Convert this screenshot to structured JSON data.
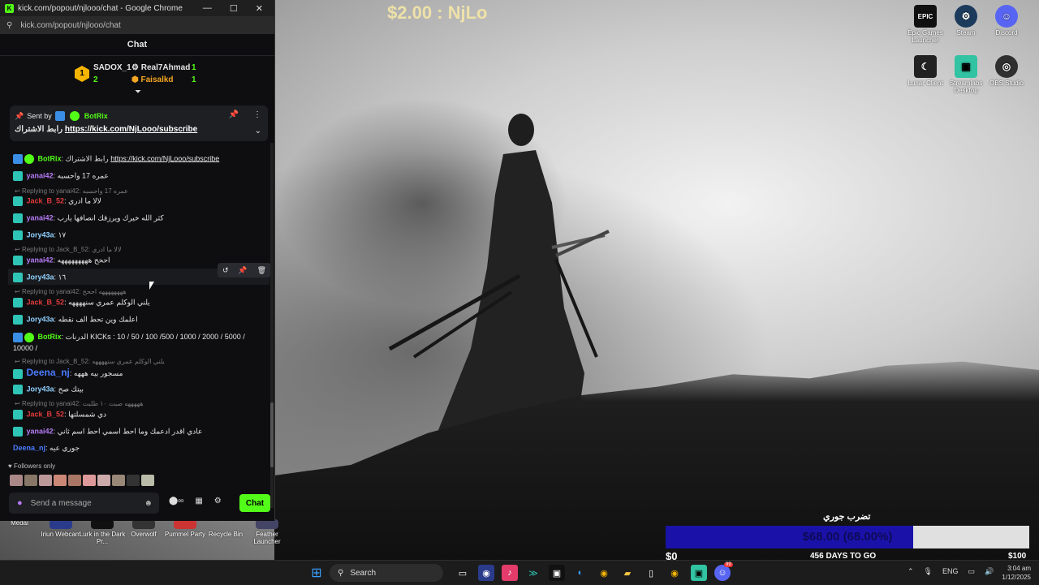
{
  "browser": {
    "window_title": "kick.com/popout/njlooo/chat - Google Chrome",
    "url": "kick.com/popout/njlooo/chat",
    "minimize": "—",
    "maximize": "☐",
    "close": "✕"
  },
  "chat": {
    "header": "Chat",
    "leaderboard": {
      "rank": "1",
      "top": {
        "name": "SADOX_1",
        "count": "2"
      },
      "second": {
        "name": "Real7Ahmad",
        "count": "1"
      },
      "third": {
        "name": "Faisalkd",
        "count": "1"
      }
    },
    "pinned": {
      "sent_by_label": "Sent by",
      "user": "BotRix",
      "text": "رابط الاشتراك",
      "link": "https://kick.com/NjLooo/subscribe"
    },
    "messages": [
      {
        "user": "BotRix",
        "text": "رابط الاشتراك",
        "link": "https://kick.com/NjLooo/subscribe"
      },
      {
        "user": "yanai42",
        "text": "عمره 17 واحسبه"
      },
      {
        "reply": "Replying to yanai42: عمره 17 واحسبه",
        "user": "Jack_B_52",
        "text": "لالا ما ادري"
      },
      {
        "user": "yanai42",
        "text": "كثر الله خيرك ويرزقك انصافها يارب"
      },
      {
        "user": "Jory43a",
        "text": "١٧"
      },
      {
        "reply": "Replying to Jack_B_52: لالا ما ادري",
        "user": "yanai42",
        "text": "اححح هههههههههه"
      },
      {
        "user": "Jory43a",
        "text": "١٦"
      },
      {
        "reply": "Replying to yanai42: ههههههههه اححح",
        "user": "Jack_B_52",
        "text": "يلني الوكلم عمري سنههههه"
      },
      {
        "user": "Jory43a",
        "text": "اعلمك وين تحط الف نقطه"
      },
      {
        "user": "BotRix",
        "text": "الدرنات KICKs : 10 / 50 / 100 /500 / 1000 / 2000 / 5000 / 10000 /"
      },
      {
        "reply": "Replying to Jack_B_52: يلني الوكلم عمري سنههههه",
        "user": "Deena_nj",
        "text": "مسجور بيه هههه"
      },
      {
        "user": "Jory43a",
        "text": "بيتك صح"
      },
      {
        "reply": "Replying to yanai42: هههههه صبت ١٠ طلبت",
        "user": "Jack_B_52",
        "text": "دي شمسلتها"
      },
      {
        "user": "yanai42",
        "text": "عادي اقدر ادعمك وما احط اسمي احط اسم ثاني"
      },
      {
        "user": "Deena_nj",
        "text": "جوري عيه"
      }
    ],
    "followers_only": "Followers only",
    "input_placeholder": "Send a message",
    "infinity": "∞",
    "send_button": "Chat"
  },
  "overlay": {
    "donation": "$2.00 : NjLo"
  },
  "desktop_icons": [
    {
      "label": "Epic Games Launcher",
      "icon": "epic-games-icon"
    },
    {
      "label": "Steam",
      "icon": "steam-icon"
    },
    {
      "label": "Discord",
      "icon": "discord-icon"
    },
    {
      "label": "Lunar Client",
      "icon": "lunar-client-icon"
    },
    {
      "label": "Streamlabs Desktop",
      "icon": "streamlabs-icon"
    },
    {
      "label": "OBS Studio",
      "icon": "obs-icon"
    },
    {
      "label": "Medal",
      "icon": "medal-icon"
    },
    {
      "label": "Iriun Webcam",
      "icon": "webcam-icon"
    },
    {
      "label": "Lurk in the Dark Pr...",
      "icon": "game-icon"
    },
    {
      "label": "Overwolf",
      "icon": "overwolf-icon"
    },
    {
      "label": "Pummel Party",
      "icon": "pummel-party-icon"
    },
    {
      "label": "Recycle Bin",
      "icon": "recycle-bin-icon"
    },
    {
      "label": "Feather Launcher",
      "icon": "feather-icon"
    }
  ],
  "goal": {
    "title": "تضرب جوري",
    "text": "$68.00 (68.00%)",
    "progress": 0.68,
    "min": "$0",
    "days": "456 DAYS TO GO",
    "max": "$100"
  },
  "taskbar": {
    "search_label": "Search",
    "language": "ENG",
    "time": "3:04 am",
    "date": "1/12/2025",
    "discord_badge": "99"
  },
  "colors": {
    "kick_green": "#53fc18",
    "goal_fill": "#1a12a8"
  }
}
